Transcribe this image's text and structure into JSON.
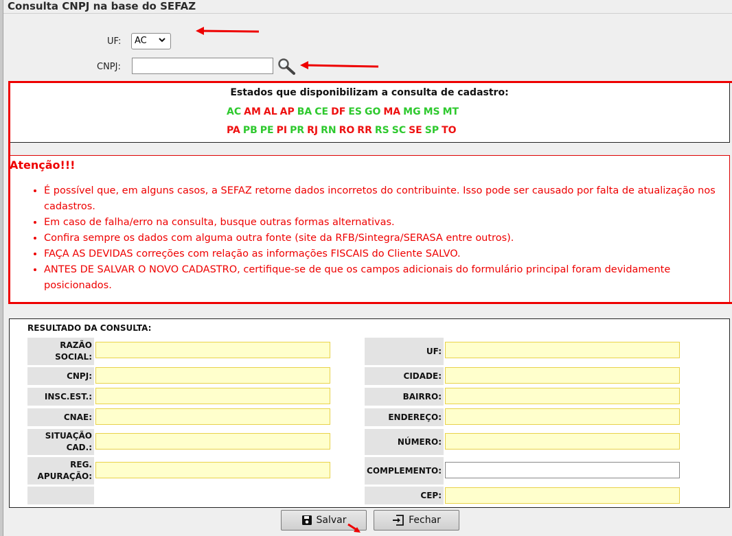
{
  "window": {
    "title": "Consulta CNPJ na base do SEFAZ"
  },
  "form": {
    "uf_label": "UF:",
    "uf_value": "AC",
    "cnpj_label": "CNPJ:",
    "cnpj_value": ""
  },
  "states": {
    "title": "Estados que disponibilizam a consulta de cadastro:",
    "row1": [
      {
        "code": "AC",
        "color": "#2ec92e"
      },
      {
        "code": "AM",
        "color": "#ee1111"
      },
      {
        "code": "AL",
        "color": "#ee1111"
      },
      {
        "code": "AP",
        "color": "#ee1111"
      },
      {
        "code": "BA",
        "color": "#2ec92e"
      },
      {
        "code": "CE",
        "color": "#2ec92e"
      },
      {
        "code": "DF",
        "color": "#ee1111"
      },
      {
        "code": "ES",
        "color": "#2ec92e"
      },
      {
        "code": "GO",
        "color": "#2ec92e"
      },
      {
        "code": "MA",
        "color": "#ee1111"
      },
      {
        "code": "MG",
        "color": "#2ec92e"
      },
      {
        "code": "MS",
        "color": "#2ec92e"
      },
      {
        "code": "MT",
        "color": "#2ec92e"
      }
    ],
    "row2": [
      {
        "code": "PA",
        "color": "#ee1111"
      },
      {
        "code": "PB",
        "color": "#2ec92e"
      },
      {
        "code": "PE",
        "color": "#2ec92e"
      },
      {
        "code": "PI",
        "color": "#ee1111"
      },
      {
        "code": "PR",
        "color": "#2ec92e"
      },
      {
        "code": "RJ",
        "color": "#ee1111"
      },
      {
        "code": "RN",
        "color": "#2ec92e"
      },
      {
        "code": "RO",
        "color": "#ee1111"
      },
      {
        "code": "RR",
        "color": "#ee1111"
      },
      {
        "code": "RS",
        "color": "#2ec92e"
      },
      {
        "code": "SC",
        "color": "#2ec92e"
      },
      {
        "code": "SE",
        "color": "#ee1111"
      },
      {
        "code": "SP",
        "color": "#2ec92e"
      },
      {
        "code": "TO",
        "color": "#ee1111"
      }
    ]
  },
  "attention": {
    "title": "Atenção!!!",
    "items": [
      "É possível que, em alguns casos, a SEFAZ retorne dados incorretos do contribuinte. Isso pode ser causado por falta de atualização nos cadastros.",
      "Em caso de falha/erro na consulta, busque outras formas alternativas.",
      "Confira sempre os dados com alguma outra fonte (site da RFB/Sintegra/SERASA entre outros).",
      "FAÇA AS DEVIDAS correções com relação as informações FISCAIS do Cliente SALVO.",
      "ANTES DE SALVAR O NOVO CADASTRO, certifique-se de que os campos adicionais do formulário principal foram devidamente posicionados."
    ]
  },
  "result": {
    "title": "RESULTADO DA CONSULTA:",
    "left": {
      "razao_social": "RAZÃO SOCIAL:",
      "cnpj": "CNPJ:",
      "insc_est": "INSC.EST.:",
      "cnae": "CNAE:",
      "situacao_cad": "SITUAÇÃO CAD.:",
      "reg_apuracao": "REG. APURAÇÃO:"
    },
    "right": {
      "uf": "UF:",
      "cidade": "CIDADE:",
      "bairro": "BAIRRO:",
      "endereco": "ENDEREÇO:",
      "numero": "NÚMERO:",
      "complemento": "COMPLEMENTO:",
      "cep": "CEP:"
    }
  },
  "buttons": {
    "save": "Salvar",
    "close": "Fechar"
  },
  "icons": {
    "search": "magnifier-icon",
    "save": "floppy-disk-icon",
    "close": "exit-icon"
  },
  "colors": {
    "highlight_red": "#ee0000",
    "field_yellow": "#ffffcc"
  }
}
